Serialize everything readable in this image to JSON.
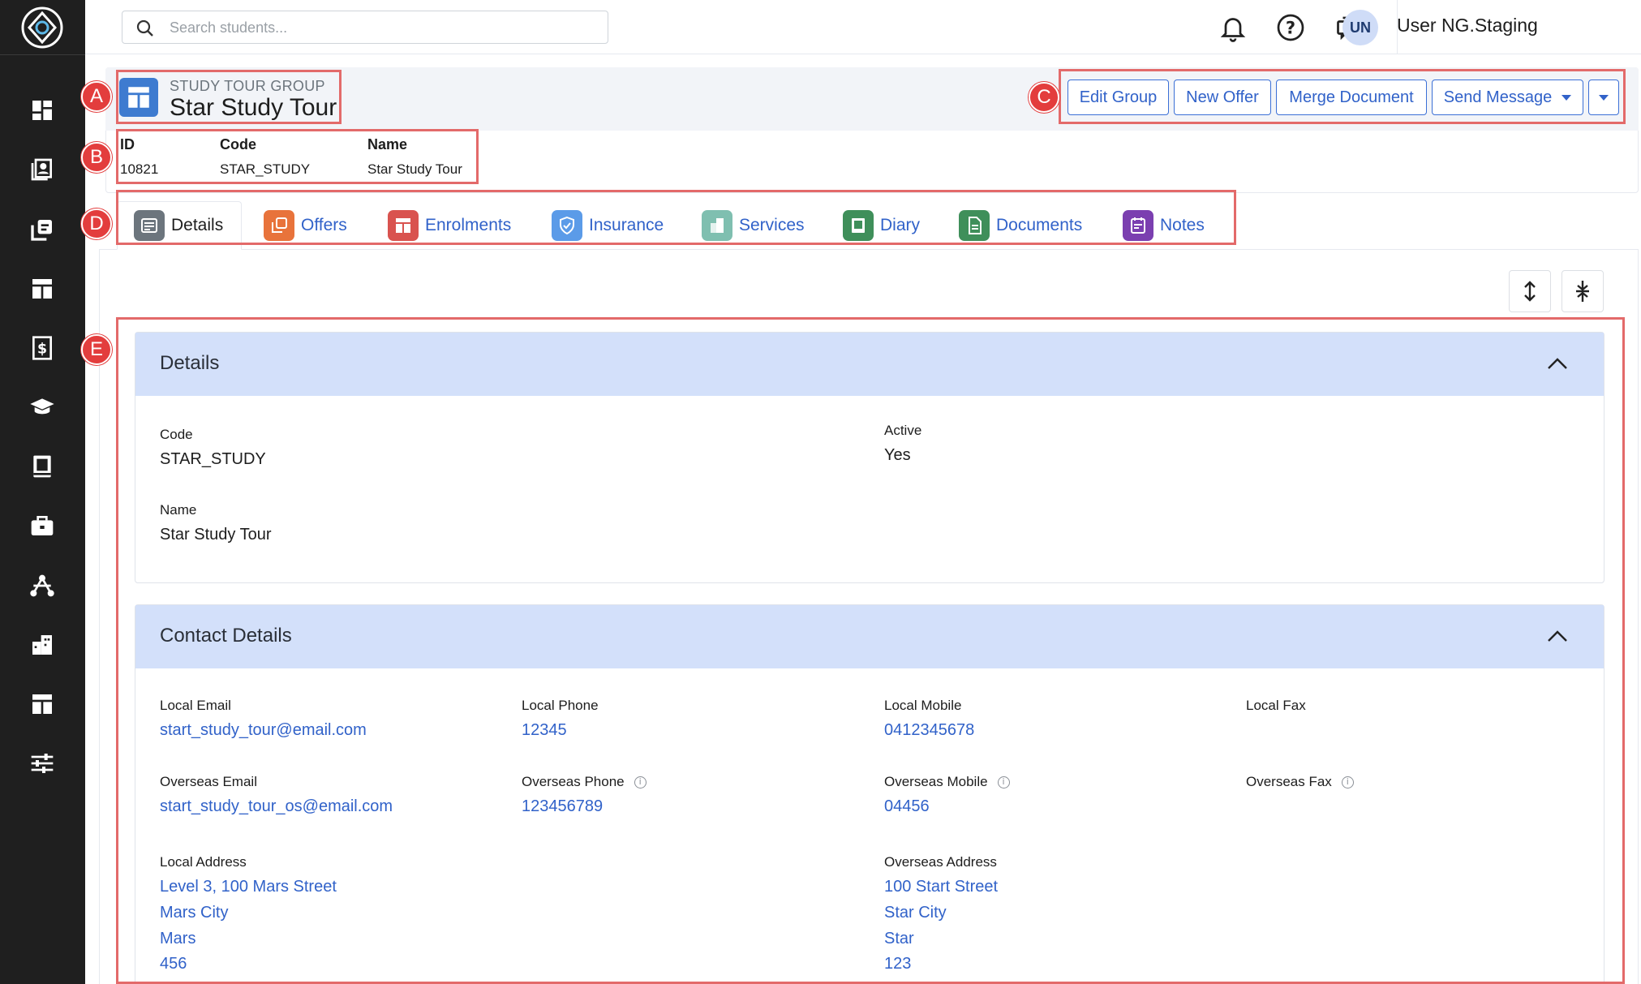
{
  "search": {
    "placeholder": "Search students..."
  },
  "topbar": {
    "avatar_initials": "UN",
    "username": "User NG.Staging"
  },
  "sidebar": {
    "icons": [
      "dashboard-icon",
      "contacts-icon",
      "offers-icon",
      "groups-icon",
      "invoice-icon",
      "graduation-cap-icon",
      "book-icon",
      "briefcase-icon",
      "network-icon",
      "building-icon",
      "layout-icon",
      "sliders-icon"
    ]
  },
  "header": {
    "type_label": "STUDY TOUR GROUP",
    "title": "Star Study Tour",
    "actions": {
      "edit": "Edit Group",
      "new_offer": "New Offer",
      "merge": "Merge Document",
      "send": "Send Message"
    },
    "meta": {
      "id_label": "ID",
      "id_value": "10821",
      "code_label": "Code",
      "code_value": "STAR_STUDY",
      "name_label": "Name",
      "name_value": "Star Study Tour"
    }
  },
  "tabs": [
    {
      "label": "Details",
      "color": "#6c757d"
    },
    {
      "label": "Offers",
      "color": "#e8733b"
    },
    {
      "label": "Enrolments",
      "color": "#d9534f"
    },
    {
      "label": "Insurance",
      "color": "#5b9be8"
    },
    {
      "label": "Services",
      "color": "#7fbfb0"
    },
    {
      "label": "Diary",
      "color": "#3f8f5a"
    },
    {
      "label": "Documents",
      "color": "#3f8f5a"
    },
    {
      "label": "Notes",
      "color": "#7b3fb0"
    }
  ],
  "details": {
    "title": "Details",
    "code_label": "Code",
    "code_value": "STAR_STUDY",
    "active_label": "Active",
    "active_value": "Yes",
    "name_label": "Name",
    "name_value": "Star Study Tour"
  },
  "contact": {
    "title": "Contact Details",
    "local_email_label": "Local Email",
    "local_email": "start_study_tour@email.com",
    "local_phone_label": "Local Phone",
    "local_phone": "12345",
    "local_mobile_label": "Local Mobile",
    "local_mobile": "0412345678",
    "local_fax_label": "Local Fax",
    "overseas_email_label": "Overseas Email",
    "overseas_email": "start_study_tour_os@email.com",
    "overseas_phone_label": "Overseas Phone",
    "overseas_phone": "123456789",
    "overseas_mobile_label": "Overseas Mobile",
    "overseas_mobile": "04456",
    "overseas_fax_label": "Overseas Fax",
    "local_address_label": "Local Address",
    "local_address": [
      "Level 3, 100 Mars Street",
      "Mars City",
      "Mars",
      "456"
    ],
    "overseas_address_label": "Overseas Address",
    "overseas_address": [
      "100 Start Street",
      "Star City",
      "Star",
      "123"
    ]
  },
  "annotations": [
    "A",
    "B",
    "C",
    "D",
    "E"
  ],
  "colors": {
    "accent": "#3162c9",
    "annotation": "#e33d3d",
    "card_header": "#d3e0fa"
  }
}
